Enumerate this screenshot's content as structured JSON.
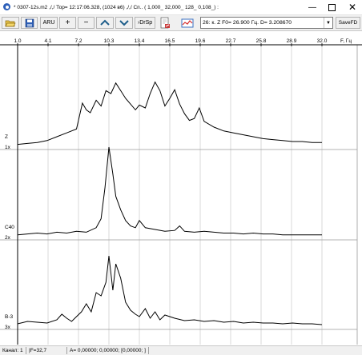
{
  "window": {
    "title": "* 0307-12s.m2 ,/,/ Тор= 12:17:06.328, (1024 в6) ,/,/ Сп.. (   1,000_  32,000_   128_  0,108_) :",
    "minimize_glyph": "—",
    "close_glyph": "✕"
  },
  "toolbar": {
    "aru_label": "ARU",
    "plus_label": "+",
    "minus_label": "−",
    "drsp_label": "›DrSp",
    "combo_value": "26: к. Z  F0= 26.900 Гц.  D= 3.208670",
    "savefd_label": "SaveFD"
  },
  "chart_data": {
    "type": "line",
    "xlabel": "F, Гц",
    "x_ticks": [
      "1.0",
      "4.1",
      "7.2",
      "10.3",
      "13.4",
      "16.5",
      "19.6",
      "22.7",
      "25.8",
      "28.9",
      "32.0"
    ],
    "xlim": [
      1.0,
      32.0
    ],
    "grid": true,
    "series": [
      {
        "name": "Z",
        "scale_label": "1х",
        "x": [
          1.0,
          2,
          3,
          4,
          5,
          6,
          7,
          7.6,
          8,
          8.4,
          9,
          9.5,
          10,
          10.5,
          11,
          11.5,
          12,
          12.5,
          13,
          13.4,
          14,
          14.5,
          15,
          15.5,
          16,
          16.5,
          17,
          17.5,
          18,
          18.5,
          19,
          19.5,
          20,
          21,
          22,
          23,
          24,
          25,
          26,
          27,
          28,
          29,
          30,
          31,
          32
        ],
        "y": [
          0.02,
          0.03,
          0.04,
          0.06,
          0.1,
          0.14,
          0.18,
          0.45,
          0.38,
          0.35,
          0.48,
          0.42,
          0.58,
          0.55,
          0.66,
          0.58,
          0.5,
          0.44,
          0.38,
          0.43,
          0.4,
          0.55,
          0.67,
          0.58,
          0.42,
          0.5,
          0.59,
          0.44,
          0.34,
          0.27,
          0.29,
          0.4,
          0.26,
          0.2,
          0.16,
          0.14,
          0.12,
          0.1,
          0.08,
          0.07,
          0.06,
          0.05,
          0.05,
          0.04,
          0.04
        ]
      },
      {
        "name": "С40",
        "scale_label": "2х",
        "x": [
          1.0,
          2,
          3,
          4,
          5,
          6,
          7,
          8,
          9,
          9.5,
          9.9,
          10.3,
          10.7,
          11,
          11.5,
          12,
          12.5,
          13,
          13.4,
          14,
          15,
          16,
          17,
          17.5,
          18,
          19,
          20,
          21,
          22,
          23,
          24,
          25,
          26,
          27,
          28,
          29,
          30,
          31,
          32
        ],
        "y": [
          0.02,
          0.03,
          0.04,
          0.03,
          0.05,
          0.04,
          0.06,
          0.05,
          0.1,
          0.2,
          0.55,
          1.0,
          0.7,
          0.45,
          0.3,
          0.18,
          0.12,
          0.1,
          0.18,
          0.1,
          0.08,
          0.06,
          0.07,
          0.12,
          0.06,
          0.05,
          0.06,
          0.05,
          0.04,
          0.04,
          0.03,
          0.04,
          0.03,
          0.03,
          0.02,
          0.02,
          0.02,
          0.02,
          0.02
        ]
      },
      {
        "name": "В-3",
        "scale_label": "3х",
        "x": [
          1.0,
          2,
          3,
          4,
          5,
          5.5,
          6,
          6.5,
          7,
          7.5,
          8,
          8.5,
          9,
          9.5,
          10,
          10.3,
          10.7,
          11,
          11.5,
          12,
          12.5,
          13,
          13.4,
          14,
          14.5,
          15,
          15.5,
          16,
          17,
          18,
          19,
          20,
          21,
          22,
          23,
          24,
          25,
          26,
          27,
          28,
          29,
          30,
          31,
          32
        ],
        "y": [
          0.03,
          0.06,
          0.05,
          0.04,
          0.08,
          0.15,
          0.1,
          0.06,
          0.12,
          0.18,
          0.28,
          0.18,
          0.42,
          0.38,
          0.55,
          0.88,
          0.45,
          0.78,
          0.6,
          0.3,
          0.2,
          0.15,
          0.12,
          0.22,
          0.1,
          0.18,
          0.08,
          0.14,
          0.1,
          0.07,
          0.08,
          0.06,
          0.07,
          0.05,
          0.06,
          0.04,
          0.05,
          0.04,
          0.04,
          0.03,
          0.04,
          0.03,
          0.03,
          0.02
        ]
      }
    ]
  },
  "statusbar": {
    "channel": "Канал: 1",
    "freq": "|F=32,7",
    "amplitude": "A= 0,00000; 0,00000; [0,00000; ]"
  }
}
